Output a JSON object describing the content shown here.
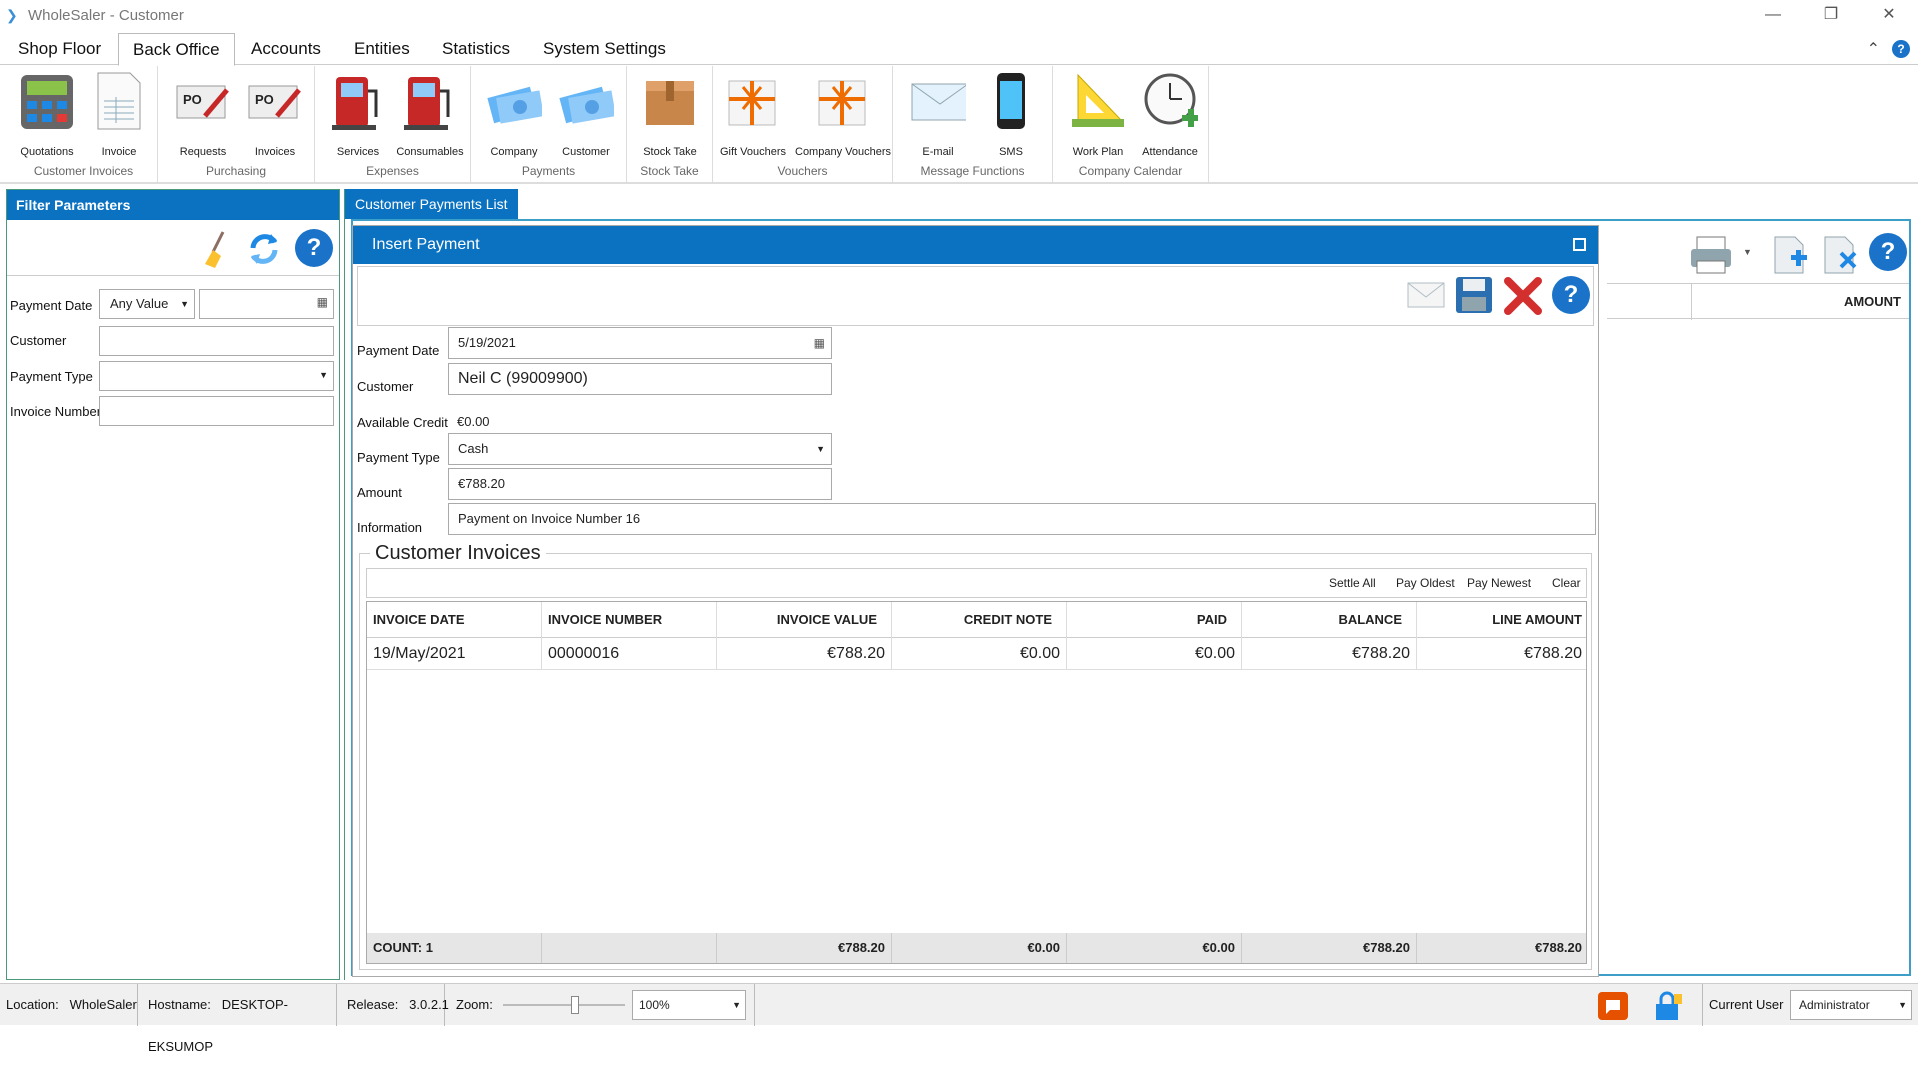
{
  "window": {
    "title": "WholeSaler - Customer",
    "minimize": "—",
    "restore": "❐",
    "close": "✕"
  },
  "menu": {
    "tabs": [
      "Shop Floor",
      "Back Office",
      "Accounts",
      "Entities",
      "Statistics",
      "System Settings"
    ],
    "active": "Back Office",
    "collapse": "⌃",
    "help": "?"
  },
  "ribbon": {
    "groups": [
      {
        "label": "Customer Invoices",
        "items": [
          "Quotations",
          "Invoice"
        ]
      },
      {
        "label": "Purchasing",
        "items": [
          "Requests",
          "Invoices"
        ]
      },
      {
        "label": "Expenses",
        "items": [
          "Services",
          "Consumables"
        ]
      },
      {
        "label": "Payments",
        "items": [
          "Company",
          "Customer"
        ]
      },
      {
        "label": "Stock Take",
        "items": [
          "Stock Take"
        ]
      },
      {
        "label": "Vouchers",
        "items": [
          "Gift Vouchers",
          "Company Vouchers"
        ]
      },
      {
        "label": "Message Functions",
        "items": [
          "E-mail",
          "SMS"
        ]
      },
      {
        "label": "Company Calendar",
        "items": [
          "Work Plan",
          "Attendance"
        ]
      }
    ],
    "po_label": "PO"
  },
  "filter": {
    "title": "Filter Parameters",
    "payment_date_label": "Payment Date",
    "payment_date_option": "Any Value",
    "customer_label": "Customer",
    "payment_type_label": "Payment Type",
    "invoice_number_label": "Invoice Number"
  },
  "main": {
    "tab": "Customer Payments List",
    "amount_header": "AMOUNT"
  },
  "dialog": {
    "title": "Insert Payment",
    "payment_date_label": "Payment Date",
    "payment_date": "5/19/2021",
    "customer_label": "Customer",
    "customer": "Neil C (99009900)",
    "credit_label": "Available Credit",
    "credit": "€0.00",
    "payment_type_label": "Payment Type",
    "payment_type": "Cash",
    "amount_label": "Amount",
    "amount": "€788.20",
    "info_label": "Information",
    "info": "Payment on Invoice Number 16"
  },
  "invoices": {
    "title": "Customer Invoices",
    "tools": [
      "Settle All",
      "Pay Oldest",
      "Pay Newest",
      "Clear"
    ],
    "headers": [
      "INVOICE DATE",
      "INVOICE NUMBER",
      "INVOICE VALUE",
      "CREDIT NOTE",
      "PAID",
      "BALANCE",
      "LINE AMOUNT"
    ],
    "rows": [
      [
        "19/May/2021",
        "00000016",
        "€788.20",
        "€0.00",
        "€0.00",
        "€788.20",
        "€788.20"
      ]
    ],
    "footer": [
      "COUNT:  1",
      "",
      "€788.20",
      "€0.00",
      "€0.00",
      "€788.20",
      "€788.20"
    ]
  },
  "status": {
    "location_label": "Location:",
    "location": "WholeSaler",
    "hostname_label": "Hostname:",
    "hostname": "DESKTOP-EKSUMOP",
    "release_label": "Release:",
    "release": "3.0.2.1",
    "zoom_label": "Zoom:",
    "zoom": "100%",
    "zoom_level": 0.6,
    "user_label": "Current User",
    "user": "Administrator"
  }
}
